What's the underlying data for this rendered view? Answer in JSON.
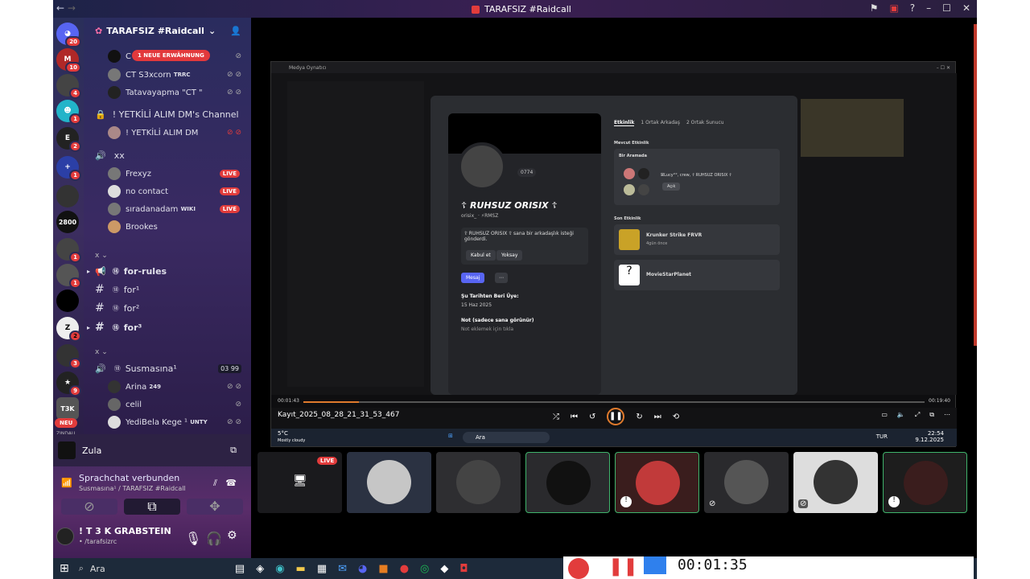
{
  "window": {
    "title": "TARAFSIZ #Raidcall",
    "back": "←",
    "fwd": "→"
  },
  "server": {
    "name": "TARAFSIZ #Raidcall",
    "mention_pill": "1 NEUE ERWÄHNUNG"
  },
  "guild_badges": [
    "20",
    "10",
    "4",
    "1",
    "2",
    "1",
    "1",
    "1",
    "2",
    "3",
    "2",
    "1",
    "2",
    "9"
  ],
  "guild_label_2800": "2800",
  "guild_label_tsk": "T3K",
  "guild_neu": "NEU",
  "guild_zindau": "ZINDAU",
  "channels": {
    "top_users": [
      {
        "name": "C"
      },
      {
        "name": "CT S3xcorn",
        "tag": "TRRC"
      },
      {
        "name": "Tatavayapma \"CT \""
      }
    ],
    "dm_channel": "! YETKİLİ ALIM DM's Channel",
    "dm_user": "! YETKİLİ ALIM DM",
    "voice_xx": "xx",
    "xx_users": [
      {
        "name": "Frexyz",
        "live": "LIVE"
      },
      {
        "name": "no contact",
        "live": "LIVE"
      },
      {
        "name": "sıradanadam",
        "tag": "WIKI",
        "live": "LIVE"
      },
      {
        "name": "Brookes"
      }
    ],
    "cat1": "x",
    "text_channels": [
      "for-rules",
      "for¹",
      "for²",
      "for³"
    ],
    "cat2": "x",
    "voice2": "Susmasına¹",
    "voice2_counts": [
      "03",
      "99"
    ],
    "voice2_users": [
      {
        "name": "Arina",
        "tag": "249"
      },
      {
        "name": "celil"
      },
      {
        "name": "YediBela Kege ¹",
        "tag": "UNTY"
      }
    ]
  },
  "stream": {
    "name": "Zula"
  },
  "voice": {
    "status": "Sprachchat verbunden",
    "channel": "Susmasına¹ / TARAFSIZ #Raidcall"
  },
  "user": {
    "name": "! T 3 K GRABSTEIN",
    "status": "• /tarafsizrc"
  },
  "player": {
    "title": "Medya Oynatıcı",
    "file": "Kayıt_2025_08_28_21_31_53_467",
    "time_cur": "00:01:43",
    "time_end": "00:19:40",
    "progress": 0.09
  },
  "profile": {
    "name": "☦ RUHSUZ ORISIX ☦",
    "handle": "orisix_ · ⚡RMSZ",
    "number": "0774",
    "request": "☦ RUHSUZ ORISIX ☦ sana bir arkadaşlık isteği gönderdi.",
    "accept": "Kabul et",
    "decline": "Yoksay",
    "message": "Mesaj",
    "since_label": "Şu Tarihten Beri Üye:",
    "since": "15 Haz 2025",
    "note_label": "Not (sadece sana görünür)",
    "note_ph": "Not eklemek için tıkla"
  },
  "tabs": [
    "Etkinlik",
    "1 Ortak Arkadaş",
    "2 Ortak Sunucu"
  ],
  "activity": {
    "current": "Mevcut Etkinlik",
    "in_call": "Bir Aramada",
    "call_names": "ꕤLucy°°, crew, ☦ RUHSUZ ORISIX ☦",
    "open": "Açık",
    "recent": "Son Etkinlik",
    "game1": "Krunker Strike FRVR",
    "game1_time": "4gün önce",
    "game2": "MovieStarPlanet"
  },
  "inner_taskbar": {
    "search": "Ara",
    "temp": "5°C",
    "weather": "Mostly cloudy",
    "lang": "TUR",
    "clock": "22:54",
    "date": "9.12.2025"
  },
  "tiles_live": "LIVE",
  "taskbar": {
    "search": "Ara"
  },
  "recorder": "00:01:35",
  "colors": {
    "live": "#e23c3c",
    "accent": "#5865f2",
    "select": "#3fb36b"
  }
}
